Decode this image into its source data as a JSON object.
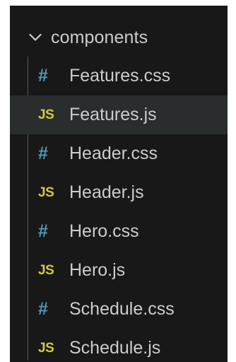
{
  "explorer": {
    "folder": {
      "label": "components",
      "icon": "chevron-down-icon",
      "expanded": true
    },
    "files": [
      {
        "name": "Features.css",
        "icon_text": "#",
        "icon": "css-file-icon",
        "selected": false
      },
      {
        "name": "Features.js",
        "icon_text": "JS",
        "icon": "js-file-icon",
        "selected": true
      },
      {
        "name": "Header.css",
        "icon_text": "#",
        "icon": "css-file-icon",
        "selected": false
      },
      {
        "name": "Header.js",
        "icon_text": "JS",
        "icon": "js-file-icon",
        "selected": false
      },
      {
        "name": "Hero.css",
        "icon_text": "#",
        "icon": "css-file-icon",
        "selected": false
      },
      {
        "name": "Hero.js",
        "icon_text": "JS",
        "icon": "js-file-icon",
        "selected": false
      },
      {
        "name": "Schedule.css",
        "icon_text": "#",
        "icon": "css-file-icon",
        "selected": false
      },
      {
        "name": "Schedule.js",
        "icon_text": "JS",
        "icon": "js-file-icon",
        "selected": false
      }
    ]
  },
  "colors": {
    "background": "#181818",
    "text": "#cccccc",
    "css_icon": "#519aba",
    "js_icon": "#cbcb41",
    "selected_row": "#2a2d2e"
  }
}
